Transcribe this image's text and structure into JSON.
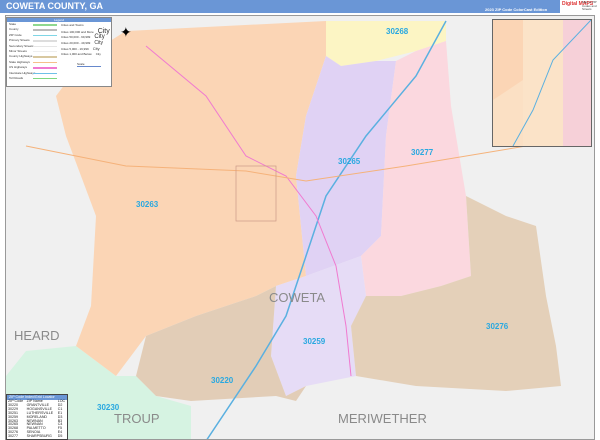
{
  "header": {
    "title": "COWETA COUNTY, GA",
    "edition": "2023 ZIP Code ColorCast Edition",
    "logo_text": "Digital MAPS",
    "logo_sub": "Map of ZIP Codes and Streets"
  },
  "legend": {
    "title": "Legend",
    "items": [
      "State",
      "County",
      "ZIP Code",
      "Primary Streets",
      "Secondary Streets",
      "Minor Streets",
      "County Highways",
      "State Highways",
      "US Highways",
      "Interstate Highways",
      "Toll Roads"
    ],
    "item_colors": [
      "#8fd88f",
      "#bbbbbb",
      "#7fd6e6",
      "#dddddd",
      "#e6e6e6",
      "#eeeeee",
      "#d8c8a0",
      "#f5c08a",
      "#f07ad0",
      "#6fc0e8",
      "#7fd87f"
    ],
    "cities_title": "Cities and Towns",
    "cities": [
      {
        "label": "Cities 100,000 and More",
        "sample": "City"
      },
      {
        "label": "Cities 50,000 - 99,999",
        "sample": "City"
      },
      {
        "label": "Cities 20,000 - 49,999",
        "sample": "City"
      },
      {
        "label": "Cities 5,000 - 19,999",
        "sample": "City"
      },
      {
        "label": "Cities 1,000 and Below",
        "sample": "City"
      }
    ],
    "scale": "Scale"
  },
  "map": {
    "zip_labels": [
      "30268",
      "30265",
      "30277",
      "30263",
      "30259",
      "30276",
      "30220",
      "30230"
    ],
    "county_labels": [
      "COWETA",
      "HEARD",
      "TROUP",
      "MERIWETHER"
    ],
    "colors": {
      "30263": "#fbd5b5",
      "30268": "#fcf5c4",
      "30265": "#e0d2f4",
      "30277": "#fbd8df",
      "30259": "#e6dcf6",
      "30276": "#e4d0b9",
      "30220": "#e2cdb7",
      "outside": "#f0f0f0",
      "troup": "#d6f3e2"
    }
  },
  "zip_index": {
    "title": "ZIP Code Index/Grid Locator",
    "columns": [
      "ZIP Code",
      "ZIP Name",
      "LOC"
    ],
    "rows": [
      [
        "30220",
        "GRANTVILLE",
        "D2"
      ],
      [
        "30229",
        "HOGANSVILLE",
        "C1"
      ],
      [
        "30251",
        "LUTHERSVILLE",
        "E1"
      ],
      [
        "30259",
        "MORELAND",
        "D3"
      ],
      [
        "30263",
        "NEWNAN",
        "B3"
      ],
      [
        "30265",
        "NEWNAN",
        "C4"
      ],
      [
        "30268",
        "PALMETTO",
        "F5"
      ],
      [
        "30276",
        "SENOIA",
        "E4"
      ],
      [
        "30277",
        "SHARPSBURG",
        "D5"
      ]
    ]
  }
}
